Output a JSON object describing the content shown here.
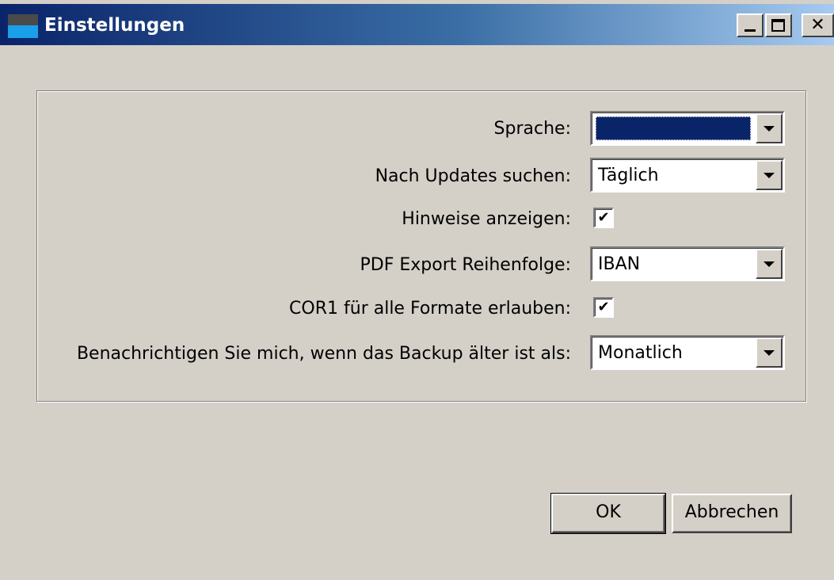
{
  "window": {
    "title": "Einstellungen",
    "controls": {
      "minimize": "_",
      "maximize": "□",
      "close": "✕"
    }
  },
  "settings": {
    "language": {
      "label": "Sprache:",
      "value": ""
    },
    "updates": {
      "label": "Nach Updates suchen:",
      "value": "Täglich"
    },
    "hints": {
      "label": "Hinweise anzeigen:",
      "checked": true,
      "mark": "✔"
    },
    "pdf_order": {
      "label": "PDF Export Reihenfolge:",
      "value": "IBAN"
    },
    "cor1": {
      "label": "COR1 für alle Formate erlauben:",
      "checked": true,
      "mark": "✔"
    },
    "backup": {
      "label": "Benachrichtigen Sie mich, wenn das Backup älter ist als:",
      "value": "Monatlich"
    }
  },
  "buttons": {
    "ok": "OK",
    "cancel": "Abbrechen"
  },
  "colors": {
    "titlebar_start": "#0a246a",
    "titlebar_end": "#a6caf0",
    "face": "#d4d0c8",
    "selection": "#0a246a"
  }
}
